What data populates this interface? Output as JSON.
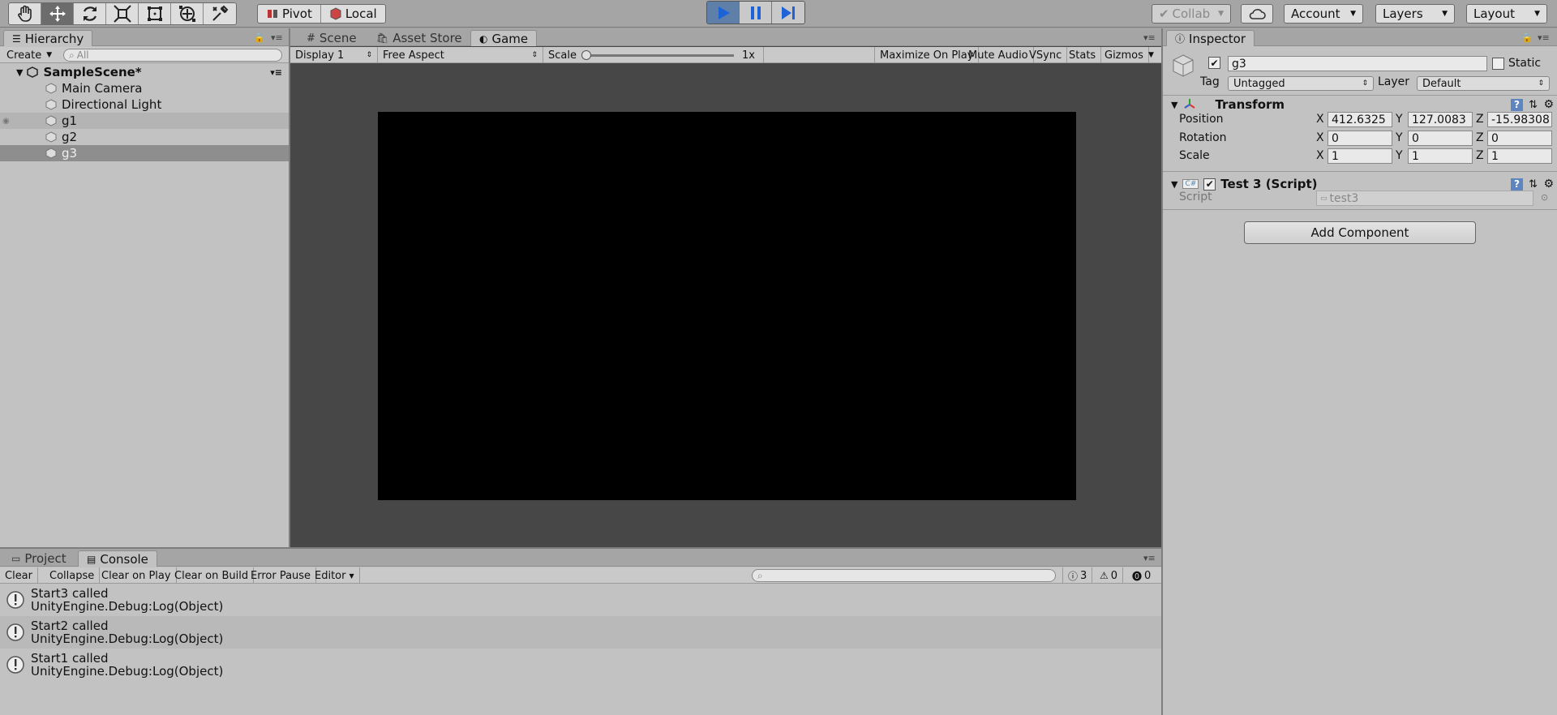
{
  "toolbar": {
    "tools": [
      "hand-tool",
      "move-tool",
      "rotate-tool",
      "scale-tool",
      "rect-tool",
      "transform-tool",
      "custom-tool"
    ],
    "pivot_label": "Pivot",
    "local_label": "Local",
    "collab_label": "Collab",
    "account_label": "Account",
    "layers_label": "Layers",
    "layout_label": "Layout"
  },
  "hierarchy": {
    "tab_label": "Hierarchy",
    "create_label": "Create",
    "search_placeholder": "All",
    "scene_name": "SampleScene*",
    "items": [
      {
        "label": "Main Camera"
      },
      {
        "label": "Directional Light"
      },
      {
        "label": "g1"
      },
      {
        "label": "g2"
      },
      {
        "label": "g3"
      }
    ]
  },
  "center": {
    "tabs": [
      "Scene",
      "Asset Store",
      "Game"
    ],
    "display_label": "Display 1",
    "aspect_label": "Free Aspect",
    "scale_label": "Scale",
    "scale_value": "1x",
    "options": [
      "Maximize On Play",
      "Mute Audio",
      "VSync",
      "Stats",
      "Gizmos"
    ]
  },
  "inspector": {
    "tab_label": "Inspector",
    "object_name": "g3",
    "static_label": "Static",
    "tag_label": "Tag",
    "tag_value": "Untagged",
    "layer_label": "Layer",
    "layer_value": "Default",
    "transform": {
      "title": "Transform",
      "position_label": "Position",
      "rotation_label": "Rotation",
      "scale_label": "Scale",
      "axis_x": "X",
      "axis_y": "Y",
      "axis_z": "Z",
      "position": {
        "x": "412.6325",
        "y": "127.0083",
        "z": "-15.98308"
      },
      "rotation": {
        "x": "0",
        "y": "0",
        "z": "0"
      },
      "scale": {
        "x": "1",
        "y": "1",
        "z": "1"
      }
    },
    "script_component": {
      "title": "Test 3 (Script)",
      "script_label": "Script",
      "script_value": "test3"
    },
    "add_component_label": "Add Component"
  },
  "bottom": {
    "tabs": [
      "Project",
      "Console"
    ],
    "buttons": [
      "Clear",
      "Collapse",
      "Clear on Play",
      "Clear on Build",
      "Error Pause",
      "Editor"
    ],
    "counts": {
      "messages": "3",
      "warnings": "0",
      "errors": "0"
    },
    "logs": [
      {
        "line1": "Start3 called",
        "line2": "UnityEngine.Debug:Log(Object)"
      },
      {
        "line1": "Start2 called",
        "line2": "UnityEngine.Debug:Log(Object)"
      },
      {
        "line1": "Start1 called",
        "line2": "UnityEngine.Debug:Log(Object)"
      }
    ]
  }
}
